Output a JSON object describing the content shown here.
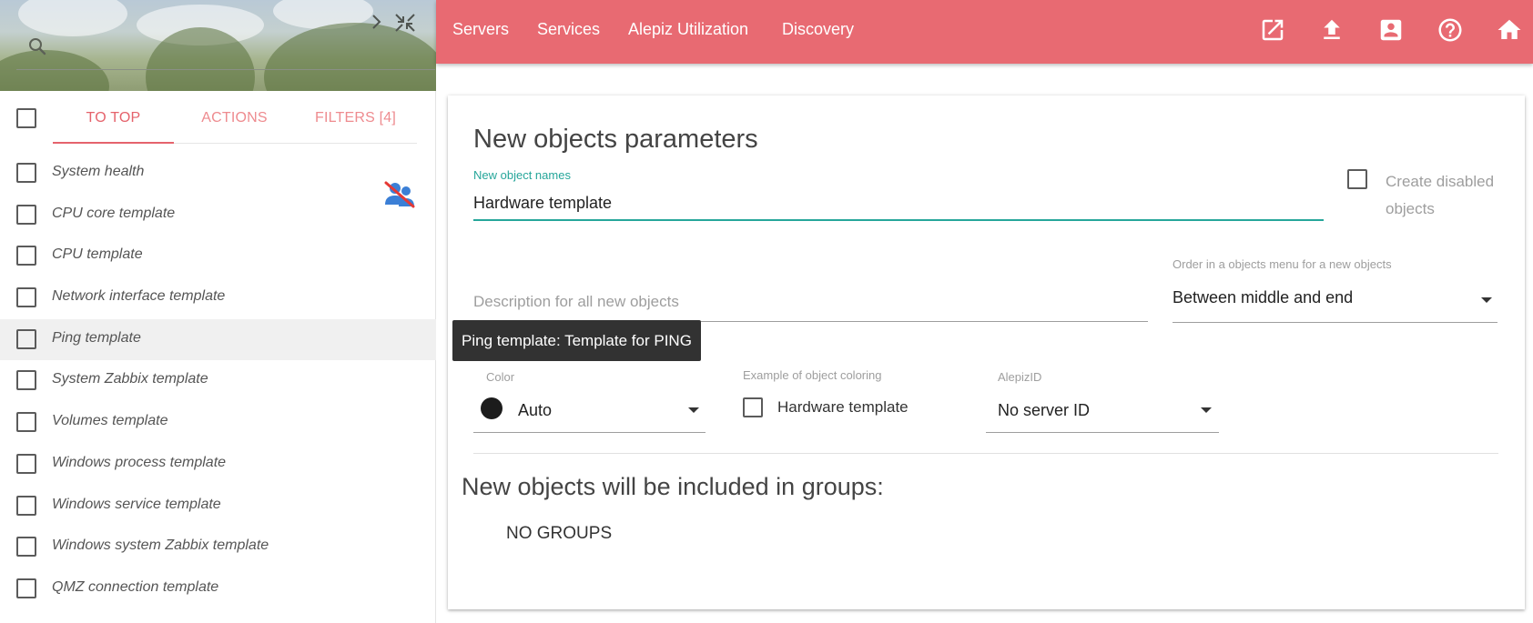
{
  "sidebar": {
    "tabs": [
      "TO TOP",
      "ACTIONS",
      "FILTERS [4]"
    ],
    "items": [
      {
        "label": "System health"
      },
      {
        "label": "CPU core template"
      },
      {
        "label": "CPU template"
      },
      {
        "label": "Network interface template"
      },
      {
        "label": "Ping template"
      },
      {
        "label": "System Zabbix template"
      },
      {
        "label": "Volumes template"
      },
      {
        "label": "Windows process template"
      },
      {
        "label": "Windows service template"
      },
      {
        "label": "Windows system Zabbix template"
      },
      {
        "label": "QMZ connection template"
      }
    ],
    "hovered_item": "Ping template",
    "icons": [
      "search-icon",
      "chevron-right-icon",
      "collapse-icon",
      "user-off-icon"
    ]
  },
  "topbar": {
    "nav": [
      "Servers",
      "Services",
      "Alepiz Utilization",
      "Discovery"
    ],
    "icons": [
      "open-in-new-icon",
      "upload-icon",
      "contact-icon",
      "help-icon",
      "home-icon"
    ]
  },
  "form": {
    "title": "New objects parameters",
    "names_label": "New object names",
    "names_value": "Hardware template",
    "create_disabled_label": "Create disabled objects",
    "description_placeholder": "Description for all new objects",
    "order_label": "Order in a objects menu for a new objects",
    "order_value": "Between middle and end",
    "color_label": "Color",
    "color_value": "Auto",
    "example_label": "Example of object coloring",
    "example_text": "Hardware template",
    "alepiz_label": "AlepizID",
    "alepiz_value": "No server ID",
    "groups_title": "New objects will be included in groups:",
    "groups_empty": "NO GROUPS"
  },
  "tooltip": "Ping template: Template for PING",
  "colors": {
    "primary": "#e86a72",
    "tab_active": "#e5636c",
    "accent_teal": "#26a69a",
    "tooltip_bg": "#323232"
  }
}
